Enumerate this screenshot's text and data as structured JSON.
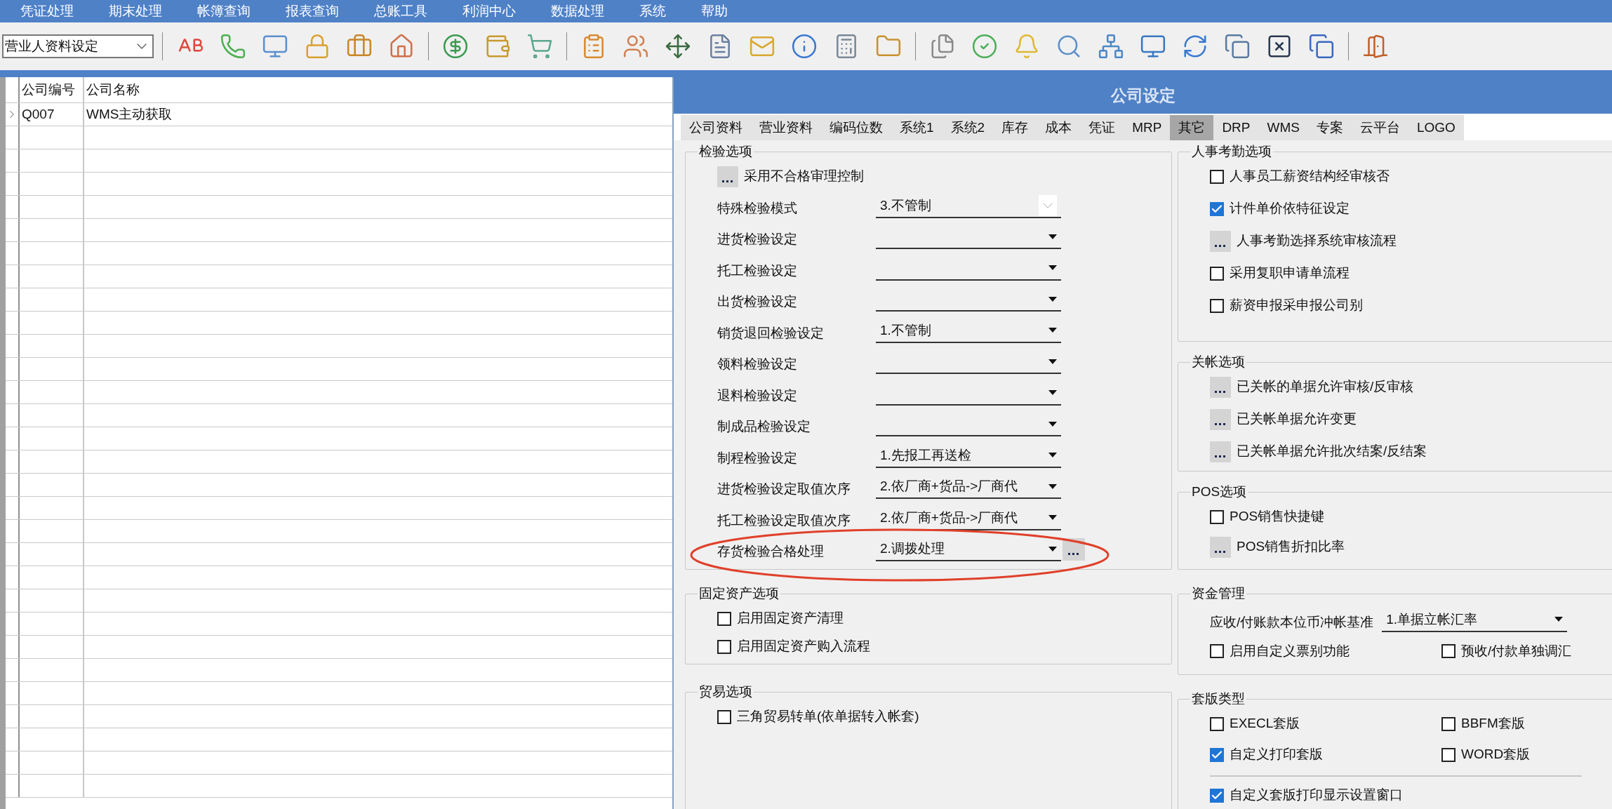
{
  "menu": [
    {
      "label": "凭证处理"
    },
    {
      "label": "期末处理"
    },
    {
      "label": "帐簿查询"
    },
    {
      "label": "报表查询"
    },
    {
      "label": "总账工具"
    },
    {
      "label": "利润中心"
    },
    {
      "label": "数据处理"
    },
    {
      "label": "系统"
    },
    {
      "label": "帮助"
    }
  ],
  "toolbar": {
    "combo": {
      "value": "营业人资料设定"
    }
  },
  "company_table": {
    "columns": [
      "公司编号",
      "公司名称"
    ],
    "rows": [
      {
        "code": "Q007",
        "name": "WMS主动获取",
        "selected": true
      }
    ]
  },
  "dialog": {
    "title": "公司设定",
    "tabs": [
      {
        "label": "公司资料",
        "selected": false
      },
      {
        "label": "营业资料",
        "selected": false
      },
      {
        "label": "编码位数",
        "selected": false
      },
      {
        "label": "系统1",
        "selected": false
      },
      {
        "label": "系统2",
        "selected": false
      },
      {
        "label": "库存",
        "selected": false
      },
      {
        "label": "成本",
        "selected": false
      },
      {
        "label": "凭证",
        "selected": false
      },
      {
        "label": "MRP",
        "selected": false
      },
      {
        "label": "其它",
        "selected": true
      },
      {
        "label": "DRP",
        "selected": false
      },
      {
        "label": "WMS",
        "selected": false
      },
      {
        "label": "专案",
        "selected": false
      },
      {
        "label": "云平台",
        "selected": false
      },
      {
        "label": "LOGO",
        "selected": false
      }
    ],
    "left_groups": [
      {
        "title": "检验选项",
        "rows": [
          {
            "items": [
              {
                "kind": "ellipsis",
                "label": "采用不合格审理控制"
              }
            ]
          },
          {
            "items": [
              {
                "kind": "combo",
                "label": "特殊检验模式",
                "value": "3.不管制"
              }
            ]
          },
          {
            "items": [
              {
                "kind": "select",
                "label": "进货检验设定"
              }
            ]
          },
          {
            "items": [
              {
                "kind": "select",
                "label": "托工检验设定"
              }
            ]
          },
          {
            "items": [
              {
                "kind": "select",
                "label": "出货检验设定"
              }
            ]
          },
          {
            "items": [
              {
                "kind": "select",
                "label": "销货退回检验设定",
                "value": "1.不管制"
              }
            ]
          },
          {
            "items": [
              {
                "kind": "select",
                "label": "领料检验设定"
              }
            ]
          },
          {
            "items": [
              {
                "kind": "select",
                "label": "退料检验设定"
              }
            ]
          },
          {
            "items": [
              {
                "kind": "select",
                "label": "制成品检验设定"
              }
            ]
          },
          {
            "items": [
              {
                "kind": "select",
                "label": "制程检验设定",
                "value": "1.先报工再送检"
              }
            ]
          },
          {
            "items": [
              {
                "kind": "select",
                "label": "进货检验设定取值次序",
                "value": "2.依厂商+货品->厂商代"
              }
            ]
          },
          {
            "items": [
              {
                "kind": "select",
                "label": "托工检验设定取值次序",
                "value": "2.依厂商+货品->厂商代"
              }
            ]
          },
          {
            "items": [
              {
                "kind": "select-more",
                "label": "存货检验合格处理",
                "value": "2.调拨处理"
              }
            ]
          }
        ]
      },
      {
        "title": "固定资产选项",
        "rows": [
          {
            "items": [
              {
                "kind": "checkbox",
                "label": "启用固定资产清理",
                "checked": false
              }
            ]
          },
          {
            "items": [
              {
                "kind": "checkbox",
                "label": "启用固定资产购入流程",
                "checked": false
              }
            ]
          }
        ]
      },
      {
        "title": "贸易选项",
        "rows": [
          {
            "items": [
              {
                "kind": "checkbox",
                "label": "三角贸易转单(依单据转入帐套)",
                "checked": false
              }
            ]
          }
        ]
      }
    ],
    "right_groups": [
      {
        "title": "人事考勤选项",
        "rows": [
          {
            "items": [
              {
                "kind": "checkbox",
                "label": "人事员工薪资结构经审核否",
                "checked": false
              }
            ]
          },
          {
            "items": [
              {
                "kind": "checkbox",
                "label": "计件单价依特征设定",
                "checked": true
              }
            ]
          },
          {
            "items": [
              {
                "kind": "ellipsis",
                "label": "人事考勤选择系统审核流程"
              }
            ]
          },
          {
            "items": [
              {
                "kind": "checkbox",
                "label": "采用复职申请单流程",
                "checked": false
              }
            ]
          },
          {
            "items": [
              {
                "kind": "checkbox",
                "label": "薪资申报采申报公司别",
                "checked": false
              }
            ]
          }
        ]
      },
      {
        "title": "关帐选项",
        "rows": [
          {
            "items": [
              {
                "kind": "ellipsis",
                "label": "已关帐的单据允许审核/反审核"
              }
            ]
          },
          {
            "items": [
              {
                "kind": "ellipsis",
                "label": "已关帐单据允许变更"
              }
            ]
          },
          {
            "items": [
              {
                "kind": "ellipsis",
                "label": "已关帐单据允许批次结案/反结案"
              }
            ]
          }
        ]
      },
      {
        "title": "POS选项",
        "rows": [
          {
            "items": [
              {
                "kind": "checkbox",
                "label": "POS销售快捷键",
                "checked": false
              }
            ]
          },
          {
            "items": [
              {
                "kind": "ellipsis",
                "label": "POS销售折扣比率"
              }
            ]
          }
        ]
      },
      {
        "title": "资金管理",
        "rows": [
          {
            "items": [
              {
                "kind": "select",
                "label": "应收/付账款本位币冲帐基准",
                "value": "1.单据立帐汇率"
              }
            ]
          },
          {
            "items": [
              {
                "kind": "checkbox",
                "label": "启用自定义票别功能",
                "checked": false
              },
              {
                "kind": "checkbox",
                "label": "预收/付款单独调汇",
                "checked": false
              }
            ]
          }
        ]
      },
      {
        "title": "套版类型",
        "rows": [
          {
            "items": [
              {
                "kind": "checkbox",
                "label": "EXECL套版",
                "checked": false
              },
              {
                "kind": "checkbox",
                "label": "BBFM套版",
                "checked": false
              }
            ]
          },
          {
            "items": [
              {
                "kind": "checkbox",
                "label": "自定义打印套版",
                "checked": true
              },
              {
                "kind": "checkbox",
                "label": "WORD套版",
                "checked": false
              }
            ]
          },
          {
            "rule_above": true,
            "items": [
              {
                "kind": "checkbox",
                "label": "自定义套版打印显示设置窗口",
                "checked": true
              }
            ]
          }
        ]
      }
    ]
  }
}
